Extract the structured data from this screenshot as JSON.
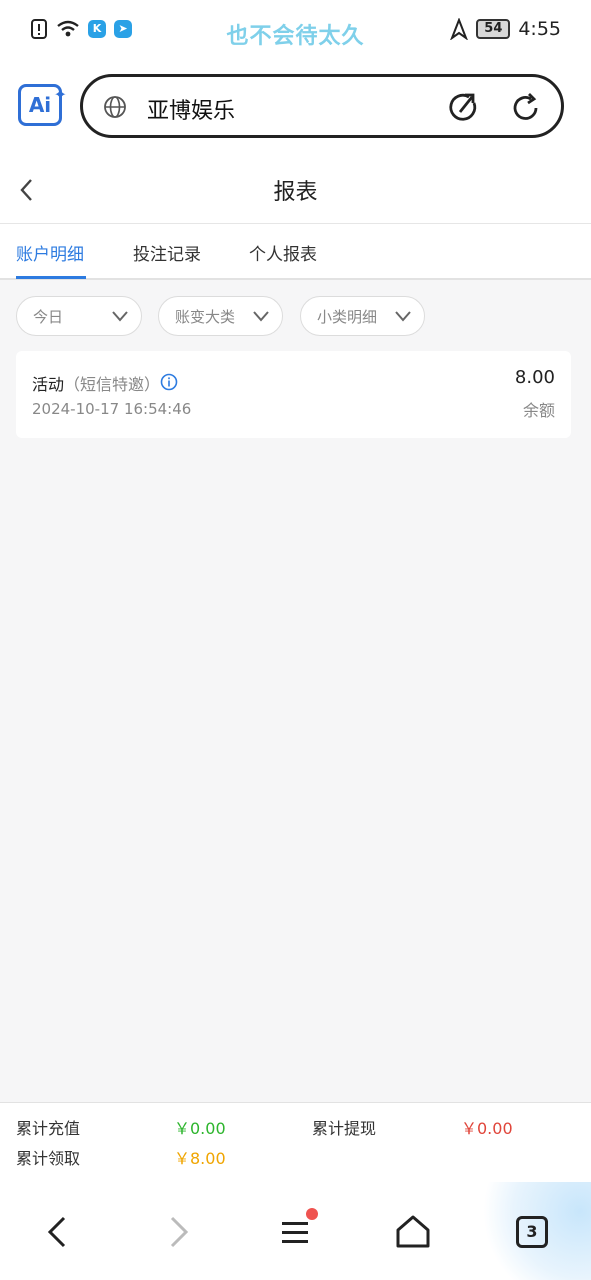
{
  "status_bar": {
    "carrier_text": "也不会待太久",
    "battery": "54",
    "time": "4:55",
    "accent_color": "#7fd0ea"
  },
  "browser": {
    "url_text": "亚博娱乐",
    "ai_logo_text": "Ai"
  },
  "page": {
    "title": "报表"
  },
  "tabs": [
    {
      "label": "账户明细",
      "active": true
    },
    {
      "label": "投注记录",
      "active": false
    },
    {
      "label": "个人报表",
      "active": false
    }
  ],
  "filters": [
    {
      "label": "今日"
    },
    {
      "label": "账变大类"
    },
    {
      "label": "小类明细"
    }
  ],
  "records": [
    {
      "title": "活动",
      "subtitle": "（短信特邀）",
      "time": "2024-10-17 16:54:46",
      "amount": "8.00",
      "balance_label": "余额"
    }
  ],
  "summary": {
    "recharge_label": "累计充值",
    "recharge_value": "￥0.00",
    "withdraw_label": "累计提现",
    "withdraw_value": "￥0.00",
    "claim_label": "累计领取",
    "claim_value": "￥8.00",
    "colors": {
      "recharge": "#2db52d",
      "withdraw": "#e0453a",
      "claim": "#f0a500"
    }
  },
  "bottom_nav": {
    "tab_count": "3"
  }
}
